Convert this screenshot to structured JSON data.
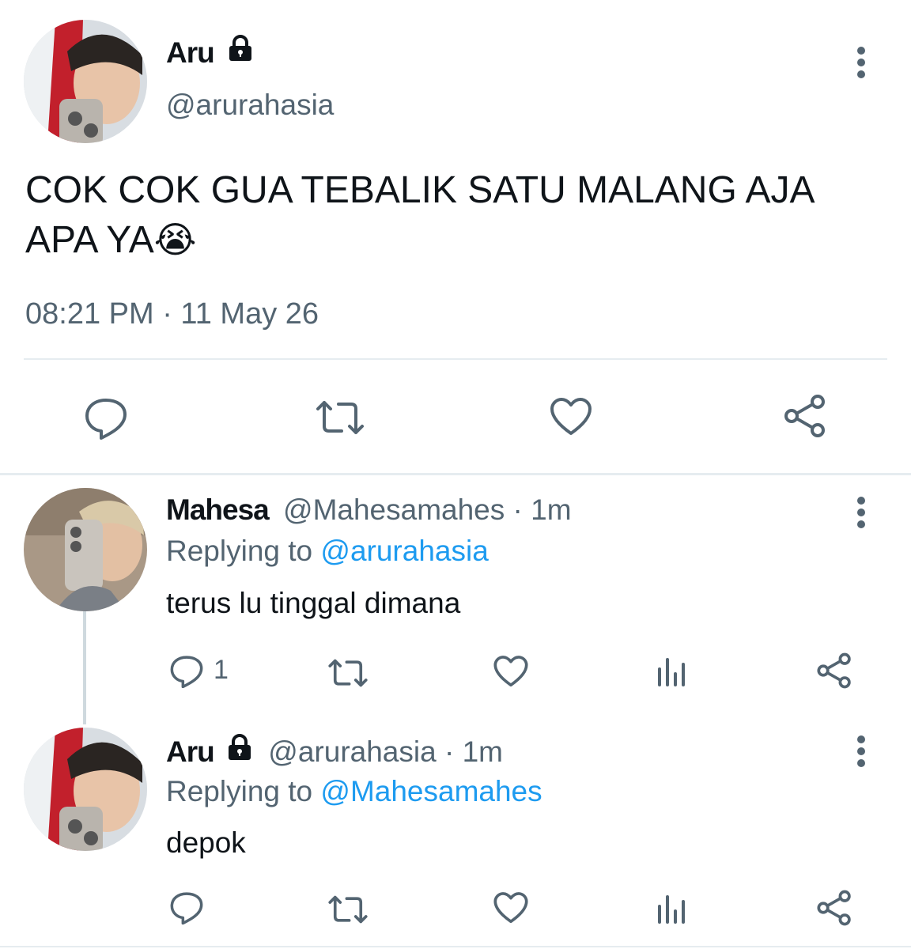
{
  "main_tweet": {
    "name": "Aru",
    "handle": "@arurahasia",
    "text_line1": "COK COK GUA TEBALIK SATU MALANG AJA",
    "text_line2": "APA YA",
    "emoji": "😭",
    "timestamp": "08:21 PM · 11 May 26"
  },
  "replies": [
    {
      "name": "Mahesa",
      "meta": "@Mahesamahes · 1m",
      "replying_prefix": "Replying to ",
      "replying_to": "@arurahasia",
      "text": "terus lu tinggal dimana",
      "reply_count": "1"
    },
    {
      "name": "Aru",
      "meta": "@arurahasia · 1m",
      "replying_prefix": "Replying to ",
      "replying_to": "@Mahesamahes",
      "text": "depok",
      "reply_count": ""
    }
  ],
  "icons": {
    "reply": "reply-icon",
    "retweet": "retweet-icon",
    "like": "like-icon",
    "share": "share-icon",
    "views": "views-icon",
    "lock": "lock-icon",
    "more": "more-icon"
  },
  "colors": {
    "text": "#0f1419",
    "muted": "#536471",
    "link": "#1d9bf0",
    "divider": "#e6ecf0"
  }
}
